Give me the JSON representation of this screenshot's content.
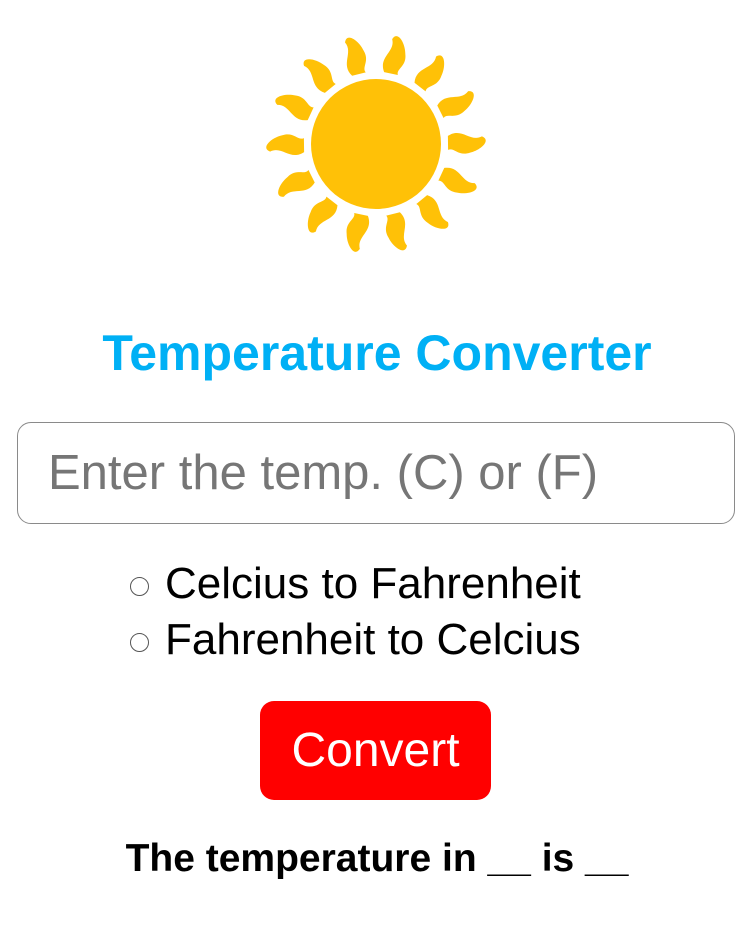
{
  "app": {
    "title": "Temperature Converter"
  },
  "logo": {
    "icon": "sun-icon",
    "color": "#FFC107"
  },
  "input": {
    "placeholder": "Enter the temp. (C) or (F)",
    "value": ""
  },
  "options": [
    {
      "label": "Celcius to Fahrenheit",
      "checked": false
    },
    {
      "label": "Fahrenheit to Celcius",
      "checked": false
    }
  ],
  "convert_button": {
    "label": "Convert",
    "color": "#FF0000"
  },
  "result": {
    "text": "The temperature in __ is __"
  },
  "colors": {
    "title": "#00B0F5",
    "background": "#FFFFFF"
  }
}
